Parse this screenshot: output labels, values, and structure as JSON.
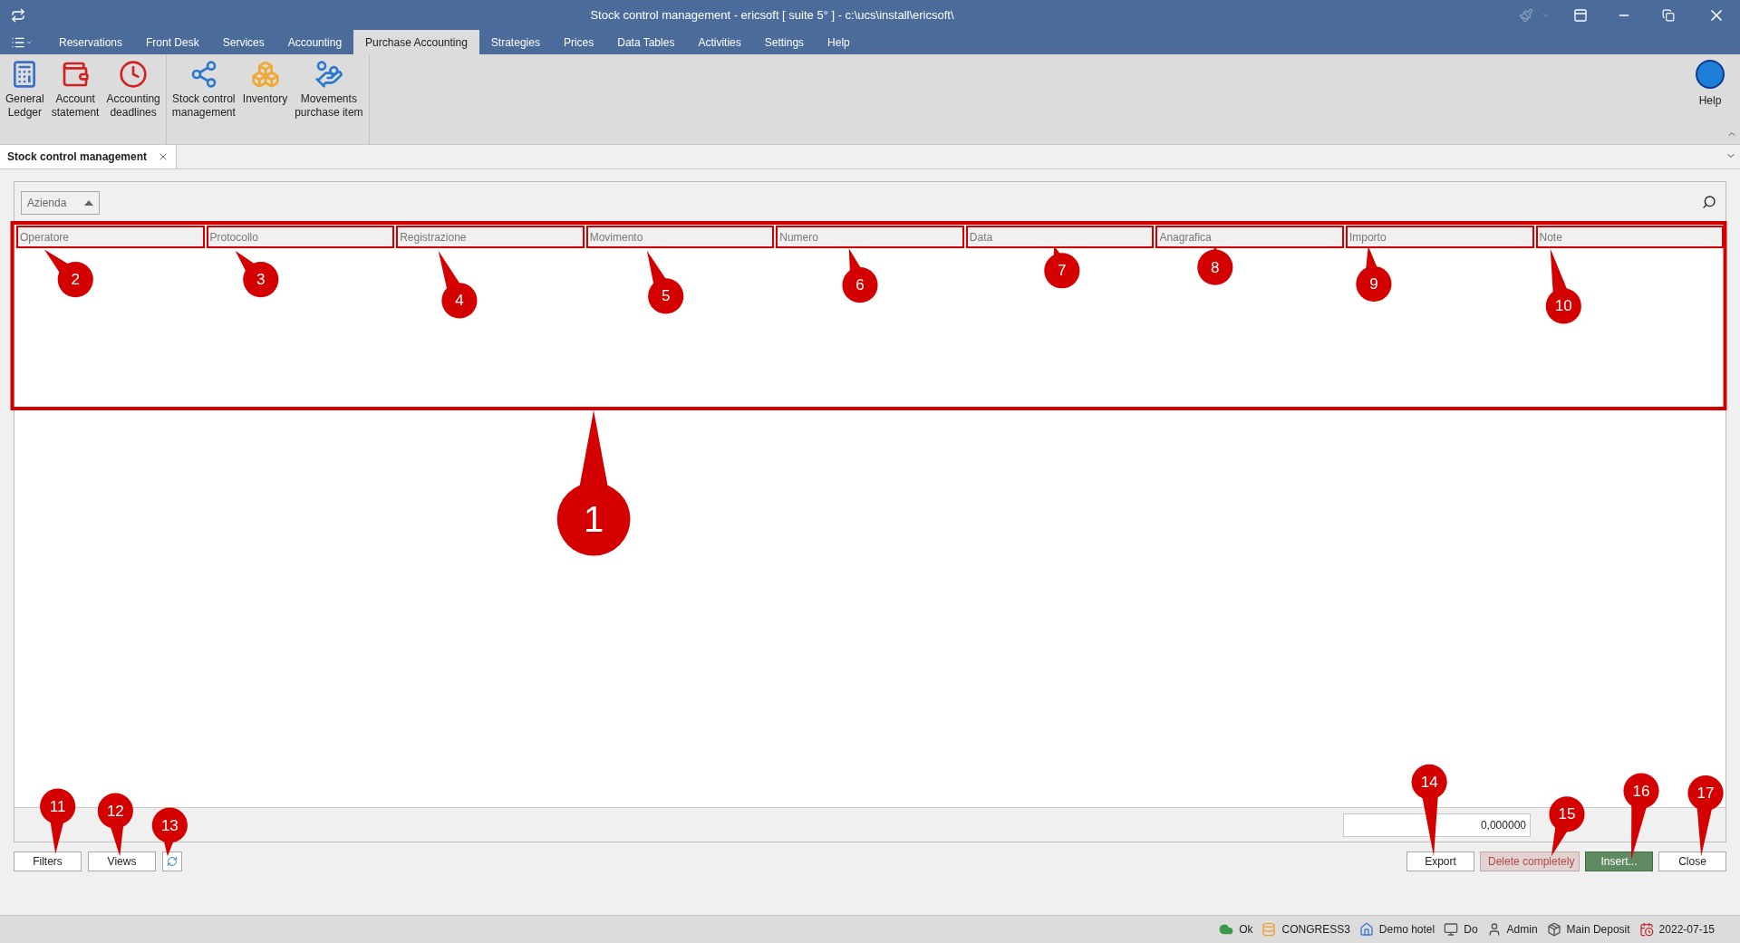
{
  "window": {
    "title": "Stock control management - ericsoft [ suite 5° ] - c:\\ucs\\install\\ericsoft\\"
  },
  "menu": [
    {
      "label": "Reservations",
      "selected": false
    },
    {
      "label": "Front Desk",
      "selected": false
    },
    {
      "label": "Services",
      "selected": false
    },
    {
      "label": "Accounting",
      "selected": false
    },
    {
      "label": "Purchase Accounting",
      "selected": true
    },
    {
      "label": "Strategies",
      "selected": false
    },
    {
      "label": "Prices",
      "selected": false
    },
    {
      "label": "Data Tables",
      "selected": false
    },
    {
      "label": "Activities",
      "selected": false
    },
    {
      "label": "Settings",
      "selected": false
    },
    {
      "label": "Help",
      "selected": false
    }
  ],
  "ribbon": {
    "groups": [
      [
        {
          "label": "General\nLedger",
          "kind": "ledger"
        },
        {
          "label": "Account\nstatement",
          "kind": "wallet"
        },
        {
          "label": "Accounting\ndeadlines",
          "kind": "clock"
        }
      ],
      [
        {
          "label": "Stock control\nmanagement",
          "kind": "stock"
        },
        {
          "label": "Inventory",
          "kind": "boxes"
        },
        {
          "label": "Movements\npurchase item",
          "kind": "movements"
        }
      ]
    ],
    "help": "Help"
  },
  "document_tabs": [
    {
      "label": "Stock control management",
      "selected": true
    }
  ],
  "filter": {
    "dropdown": "Azienda"
  },
  "table": {
    "columns": [
      "Operatore",
      "Protocollo",
      "Registrazione",
      "Movimento",
      "Numero",
      "Data",
      "Anagrafica",
      "Importo",
      "Note"
    ]
  },
  "footer_total": "0,000000",
  "left_buttons": [
    {
      "kind": "text",
      "label": "Filters"
    },
    {
      "kind": "text",
      "label": "Views"
    },
    {
      "kind": "refresh"
    }
  ],
  "right_buttons": [
    {
      "label": "Export",
      "kind": "default",
      "disabled": false
    },
    {
      "label": "Delete completely",
      "kind": "default",
      "disabled": true
    },
    {
      "label": "Insert...",
      "kind": "primary",
      "disabled": false
    },
    {
      "label": "Close",
      "kind": "default",
      "disabled": false
    }
  ],
  "status_bar": [
    {
      "kind": "cloud",
      "text": "Ok"
    },
    {
      "kind": "database",
      "text": "CONGRESS3"
    },
    {
      "kind": "home",
      "text": "Demo hotel"
    },
    {
      "kind": "monitor",
      "text": "Do"
    },
    {
      "kind": "user",
      "text": "Admin"
    },
    {
      "kind": "package",
      "text": "Main Deposit"
    },
    {
      "kind": "calendar",
      "text": "2022-07-15"
    }
  ],
  "callouts": [
    "1",
    "2",
    "3",
    "4",
    "5",
    "6",
    "7",
    "8",
    "9",
    "10",
    "11",
    "12",
    "13",
    "14",
    "15",
    "16",
    "17"
  ]
}
